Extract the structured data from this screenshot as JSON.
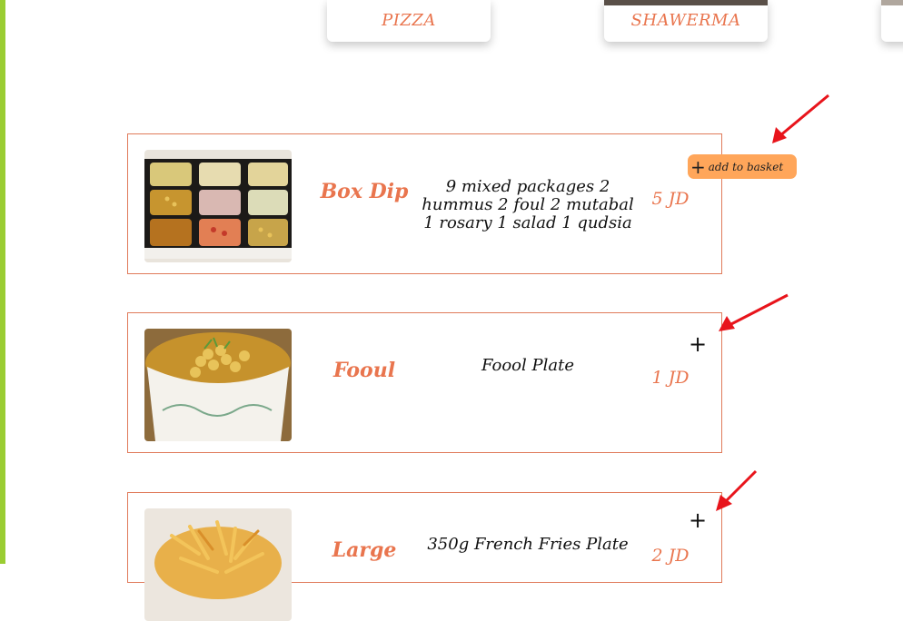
{
  "categories": [
    {
      "label": "PIZZA"
    },
    {
      "label": "SHAWERMA"
    }
  ],
  "items": [
    {
      "name": "Box Dip",
      "description": "9 mixed packages 2 hummus 2 foul 2 mutabal 1 rosary 1 salad 1 qudsia",
      "price": "5 JD",
      "image_icon": "box-dip-photo"
    },
    {
      "name": "Fooul",
      "description": "Foool Plate",
      "price": "1 JD",
      "image_icon": "fooul-photo"
    },
    {
      "name": "Large",
      "description": "350g French Fries Plate",
      "price": "2 JD",
      "image_icon": "fries-photo"
    }
  ],
  "add_to_basket": {
    "label": "add to basket",
    "icon": "plus-icon"
  },
  "plus_symbol": "+",
  "colors": {
    "accent": "#e9754e",
    "left_bar": "#9acd32",
    "basket_button": "#ffa65a",
    "annotation_arrow": "#e8141b"
  }
}
